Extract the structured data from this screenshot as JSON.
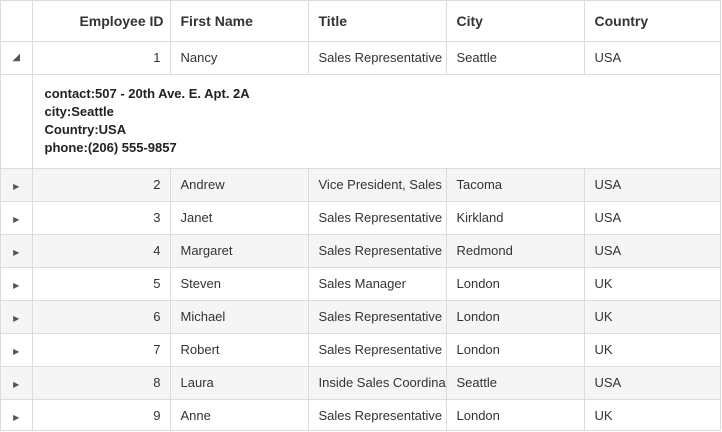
{
  "columns": [
    {
      "key": "employee_id",
      "label": "Employee ID"
    },
    {
      "key": "first_name",
      "label": "First Name"
    },
    {
      "key": "title",
      "label": "Title"
    },
    {
      "key": "city",
      "label": "City"
    },
    {
      "key": "country",
      "label": "Country"
    }
  ],
  "rows": [
    {
      "employee_id": "1",
      "first_name": "Nancy",
      "title": "Sales Representative",
      "city": "Seattle",
      "country": "USA",
      "expanded": true
    },
    {
      "employee_id": "2",
      "first_name": "Andrew",
      "title": "Vice President, Sales",
      "city": "Tacoma",
      "country": "USA",
      "expanded": false
    },
    {
      "employee_id": "3",
      "first_name": "Janet",
      "title": "Sales Representative",
      "city": "Kirkland",
      "country": "USA",
      "expanded": false
    },
    {
      "employee_id": "4",
      "first_name": "Margaret",
      "title": "Sales Representative",
      "city": "Redmond",
      "country": "USA",
      "expanded": false
    },
    {
      "employee_id": "5",
      "first_name": "Steven",
      "title": "Sales Manager",
      "city": "London",
      "country": "UK",
      "expanded": false
    },
    {
      "employee_id": "6",
      "first_name": "Michael",
      "title": "Sales Representative",
      "city": "London",
      "country": "UK",
      "expanded": false
    },
    {
      "employee_id": "7",
      "first_name": "Robert",
      "title": "Sales Representative",
      "city": "London",
      "country": "UK",
      "expanded": false
    },
    {
      "employee_id": "8",
      "first_name": "Laura",
      "title": "Inside Sales Coordinator",
      "city": "Seattle",
      "country": "USA",
      "expanded": false
    },
    {
      "employee_id": "9",
      "first_name": "Anne",
      "title": "Sales Representative",
      "city": "London",
      "country": "UK",
      "expanded": false
    }
  ],
  "detail": {
    "contact": "contact:507 - 20th Ave. E. Apt. 2A",
    "city": "city:Seattle",
    "country": "Country:USA",
    "phone": "phone:(206) 555-9857"
  },
  "icons": {
    "expanded": "caret-down-icon",
    "collapsed": "caret-right-icon"
  },
  "colors": {
    "alt_row": "#f5f5f5",
    "border": "#dcdcdc"
  }
}
